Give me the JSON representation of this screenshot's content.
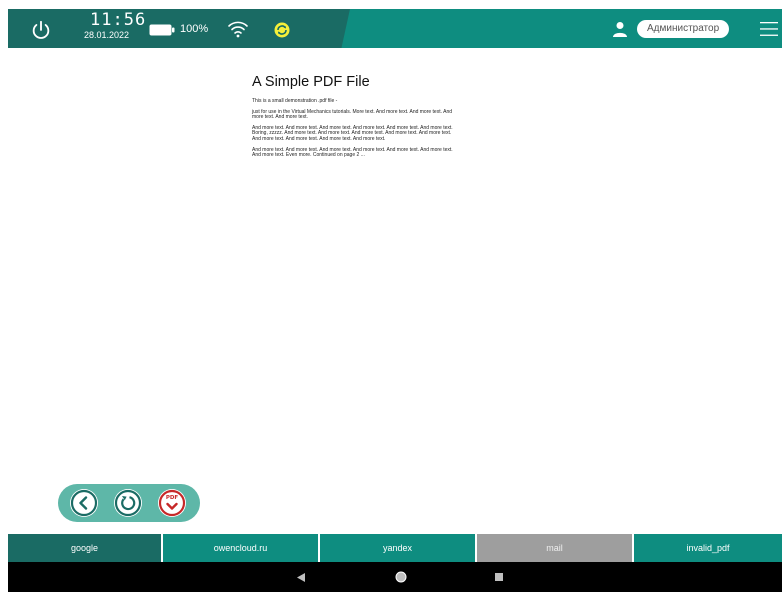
{
  "status_bar": {
    "time": "11:56",
    "date": "28.01.2022",
    "battery": "100%",
    "user_role": "Администратор",
    "icons": [
      "power-icon",
      "battery-icon",
      "wifi-icon",
      "sync-icon",
      "user-icon",
      "hamburger-menu-icon"
    ],
    "colors": {
      "bar": "#0e8d80",
      "bar_dark": "#1a6b64",
      "sync": "#f5f03a"
    }
  },
  "document": {
    "title": "A Simple PDF File",
    "paragraphs": [
      "This is a small demonstration .pdf file -",
      "just for use in the Virtual Mechanics tutorials. More text. And more text. And more text. And more text. And more text.",
      "And more text. And more text. And more text. And more text. And more text. And more text. Boring, zzzzz. And more text. And more text. And more text. And more text. And more text. And more text. And more text. And more text. And more text.",
      "And more text. And more text. And more text. And more text. And more text. And more text. And more text. Even more. Continued on page 2 ..."
    ]
  },
  "controls": {
    "buttons": [
      "back-icon",
      "refresh-icon",
      "pdf-download-icon"
    ],
    "pdf_label": "PDF",
    "color": "#5eb7a8"
  },
  "tabs": [
    {
      "label": "google",
      "state": "active"
    },
    {
      "label": "owencloud.ru",
      "state": "normal"
    },
    {
      "label": "yandex",
      "state": "normal"
    },
    {
      "label": "mail",
      "state": "disabled"
    },
    {
      "label": "invalid_pdf",
      "state": "normal"
    }
  ],
  "nav": {
    "icons": [
      "nav-back-icon",
      "nav-home-icon",
      "nav-recent-icon"
    ]
  }
}
